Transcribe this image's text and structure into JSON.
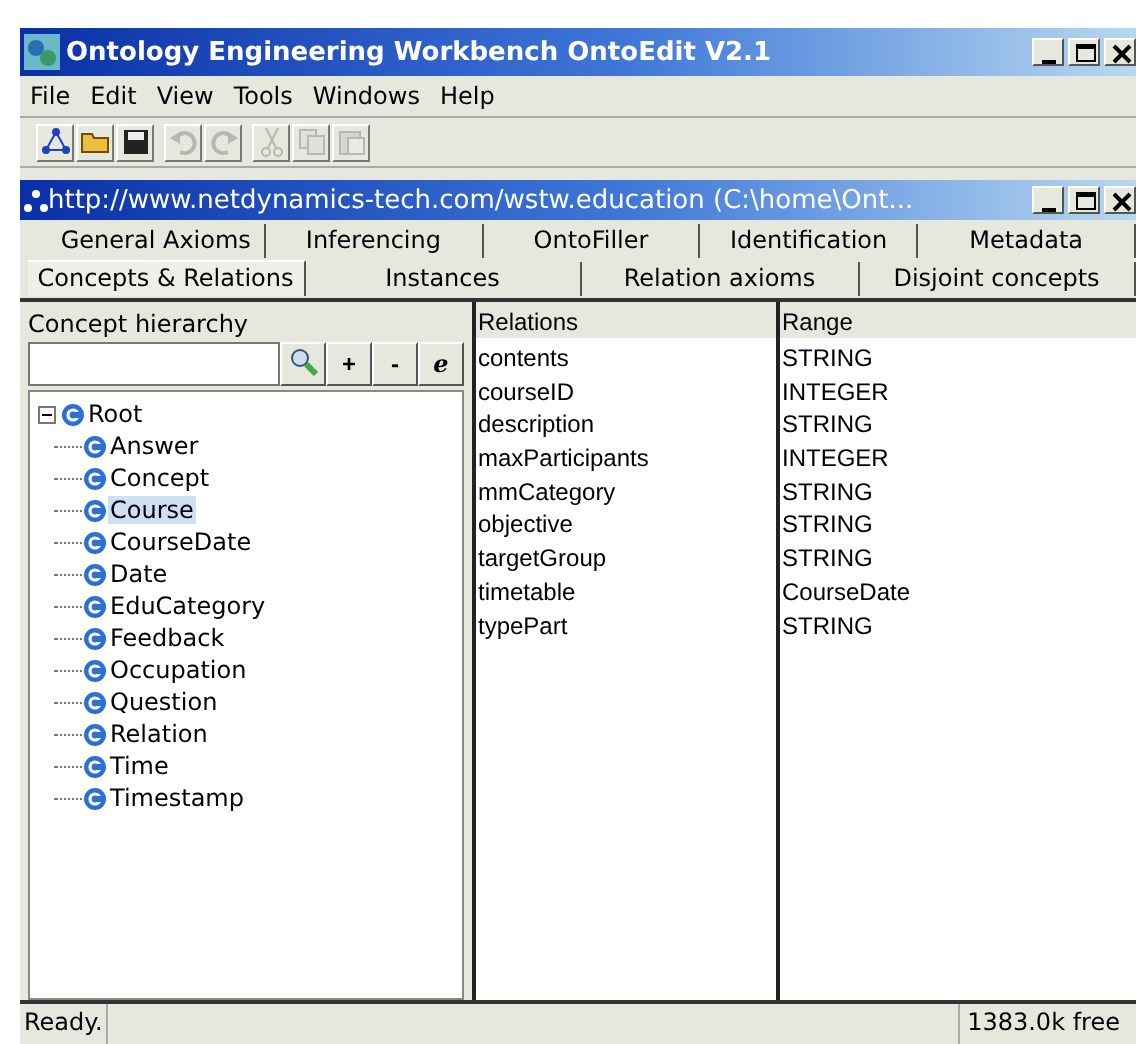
{
  "window": {
    "title": "Ontology Engineering Workbench OntoEdit V2.1"
  },
  "menu": [
    "File",
    "Edit",
    "View",
    "Tools",
    "Windows",
    "Help"
  ],
  "toolbar": [
    {
      "kind": "hierarchy",
      "disabled": false
    },
    {
      "kind": "open",
      "disabled": false
    },
    {
      "kind": "save",
      "disabled": false
    },
    {
      "kind": "sep"
    },
    {
      "kind": "undo",
      "disabled": true
    },
    {
      "kind": "redo",
      "disabled": true
    },
    {
      "kind": "sep"
    },
    {
      "kind": "cut",
      "disabled": true
    },
    {
      "kind": "copy",
      "disabled": true
    },
    {
      "kind": "paste",
      "disabled": true
    }
  ],
  "document": {
    "title": "http://www.netdynamics-tech.com/wstw.education (C:\\home\\Ont..."
  },
  "tab_rows": [
    [
      {
        "label": "General Axioms",
        "selected": false
      },
      {
        "label": "Inferencing",
        "selected": false
      },
      {
        "label": "OntoFiller",
        "selected": false
      },
      {
        "label": "Identification",
        "selected": false
      },
      {
        "label": "Metadata",
        "selected": false
      }
    ],
    [
      {
        "label": "Concepts & Relations",
        "selected": true
      },
      {
        "label": "Instances",
        "selected": false
      },
      {
        "label": "Relation axioms",
        "selected": false
      },
      {
        "label": "Disjoint concepts",
        "selected": false
      }
    ]
  ],
  "hierarchy": {
    "title": "Concept hierarchy",
    "buttons": [
      {
        "kind": "search"
      },
      {
        "kind": "text",
        "label": "+"
      },
      {
        "kind": "text",
        "label": "-"
      },
      {
        "kind": "text",
        "label": "e"
      }
    ],
    "tree": [
      {
        "label": "Root",
        "expanded": true,
        "selected": false,
        "children": [
          {
            "label": "Answer",
            "selected": false
          },
          {
            "label": "Concept",
            "selected": false
          },
          {
            "label": "Course",
            "selected": true
          },
          {
            "label": "CourseDate",
            "selected": false
          },
          {
            "label": "Date",
            "selected": false
          },
          {
            "label": "EduCategory",
            "selected": false
          },
          {
            "label": "Feedback",
            "selected": false
          },
          {
            "label": "Occupation",
            "selected": false
          },
          {
            "label": "Question",
            "selected": false
          },
          {
            "label": "Relation",
            "selected": false
          },
          {
            "label": "Time",
            "selected": false
          },
          {
            "label": "Timestamp",
            "selected": false
          }
        ]
      }
    ]
  },
  "table": {
    "columns": [
      "Relations",
      "Range"
    ],
    "rows": [
      [
        "contents",
        "STRING"
      ],
      [
        "courseID",
        "INTEGER"
      ],
      [
        "description",
        "STRING"
      ],
      [
        "maxParticipants",
        "INTEGER"
      ],
      [
        "mmCategory",
        "STRING"
      ],
      [
        "objective",
        "STRING"
      ],
      [
        "targetGroup",
        "STRING"
      ],
      [
        "timetable",
        "CourseDate"
      ],
      [
        "typePart",
        "STRING"
      ]
    ]
  },
  "status_bar": {
    "message": "Ready.",
    "memory": "1383.0k free"
  }
}
